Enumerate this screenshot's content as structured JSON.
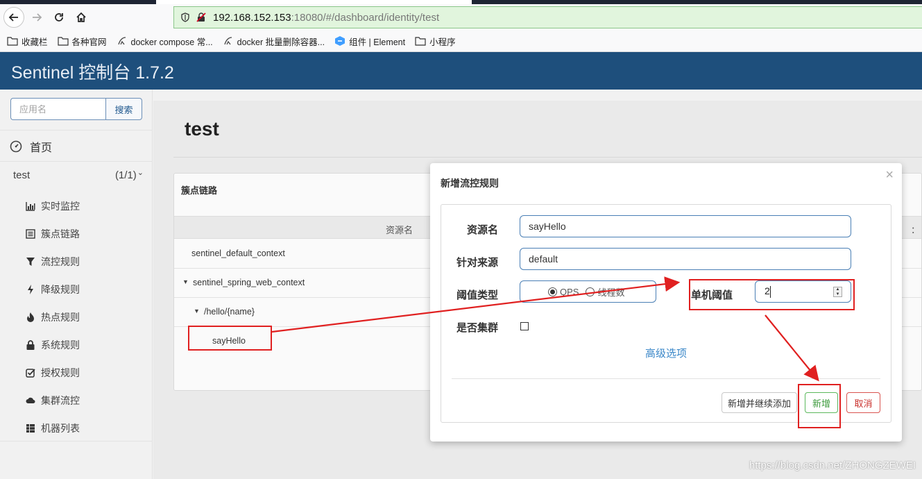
{
  "browser": {
    "url_host": "192.168.152.153",
    "url_rest": ":18080/#/dashboard/identity/test",
    "bookmarks": [
      {
        "label": "收藏栏",
        "icon": "folder-icon"
      },
      {
        "label": "各种官网",
        "icon": "folder-icon"
      },
      {
        "label": "docker compose 常...",
        "icon": "bookmark-site-icon"
      },
      {
        "label": "docker 批量删除容器...",
        "icon": "bookmark-site-icon"
      },
      {
        "label": "组件 | Element",
        "icon": "element-logo-icon"
      },
      {
        "label": "小程序",
        "icon": "folder-icon"
      }
    ]
  },
  "header": {
    "title": "Sentinel 控制台 1.7.2"
  },
  "sidebar": {
    "search_placeholder": "应用名",
    "search_button": "搜索",
    "home_label": "首页",
    "app_name": "test",
    "app_count": "(1/1)",
    "menu": [
      {
        "label": "实时监控",
        "icon": "bar-chart-icon"
      },
      {
        "label": "簇点链路",
        "icon": "list-icon"
      },
      {
        "label": "流控规则",
        "icon": "filter-icon"
      },
      {
        "label": "降级规则",
        "icon": "flash-icon"
      },
      {
        "label": "热点规则",
        "icon": "fire-icon"
      },
      {
        "label": "系统规则",
        "icon": "lock-icon"
      },
      {
        "label": "授权规则",
        "icon": "check-square-icon"
      },
      {
        "label": "集群流控",
        "icon": "cloud-icon"
      },
      {
        "label": "机器列表",
        "icon": "th-list-icon"
      }
    ]
  },
  "main": {
    "page_title": "test",
    "panel_title": "簇点链路",
    "table_header": {
      "resource": "资源名",
      "right_cut": "："
    },
    "rows": [
      {
        "label": "sentinel_default_context"
      },
      {
        "label": "sentinel_spring_web_context"
      },
      {
        "label": "/hello/{name}"
      },
      {
        "label": "sayHello"
      }
    ]
  },
  "modal": {
    "title": "新增流控规则",
    "close": "×",
    "resource_label": "资源名",
    "resource_value": "sayHello",
    "origin_label": "针对来源",
    "origin_value": "default",
    "grade_label": "阈值类型",
    "grade_options": [
      "QPS",
      "线程数"
    ],
    "grade_selected": "QPS",
    "threshold_label": "单机阈值",
    "threshold_value": "2",
    "cluster_label": "是否集群",
    "advanced_link": "高级选项",
    "btn_add_continue": "新增并继续添加",
    "btn_add": "新增",
    "btn_cancel": "取消"
  },
  "watermark": "https://blog.csdn.net/ZHONGZEWEI",
  "colors": {
    "header_bg": "#1e4f7c",
    "annotation": "#e02020",
    "link": "#3a87c8"
  }
}
